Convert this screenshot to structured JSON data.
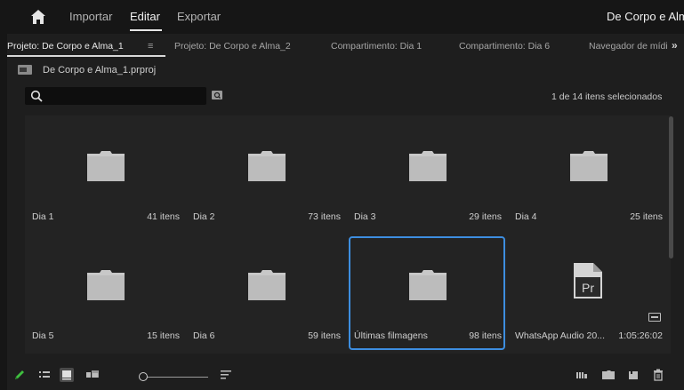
{
  "menu": {
    "items": [
      "Importar",
      "Editar",
      "Exportar"
    ],
    "active": "Editar",
    "document_title": "De Corpo e Alma"
  },
  "tabs": [
    {
      "label": "Projeto: De Corpo e Alma_1"
    },
    {
      "label": "Projeto: De Corpo e Alma_2"
    },
    {
      "label": "Compartimento: Dia 1"
    },
    {
      "label": "Compartimento: Dia 6"
    },
    {
      "label": "Navegador de mídi"
    }
  ],
  "tab_menu_glyph": "≡",
  "tab_more_glyph": "»",
  "project": {
    "filename": "De Corpo e Alma_1.prproj"
  },
  "search": {
    "value": "",
    "placeholder": ""
  },
  "selection_status": "1 de 14 itens selecionados",
  "bins": [
    {
      "name": "Dia 1",
      "count": "41 itens",
      "type": "folder"
    },
    {
      "name": "Dia 2",
      "count": "73 itens",
      "type": "folder"
    },
    {
      "name": "Dia 3",
      "count": "29 itens",
      "type": "folder"
    },
    {
      "name": "Dia 4",
      "count": "25 itens",
      "type": "folder"
    },
    {
      "name": "Dia 5",
      "count": "15 itens",
      "type": "folder"
    },
    {
      "name": "Dia 6",
      "count": "59 itens",
      "type": "folder"
    },
    {
      "name": "Últimas filmagens",
      "count": "98 itens",
      "type": "folder",
      "selected": true
    },
    {
      "name": "WhatsApp Audio 20...",
      "count": "1:05:26:02",
      "type": "premiere-sequence",
      "icon_text": "Pr"
    }
  ],
  "colors": {
    "selection_border": "#3d8ee0",
    "pen_tool_icon": "#3fbf3f",
    "background": "#1e1e1e"
  },
  "toolbar_icons": [
    "pencil-icon",
    "list-view-icon",
    "icon-view-icon",
    "freeform-view-icon",
    "zoom-slider",
    "sort-icon",
    "automate-to-sequence-icon",
    "new-bin-icon",
    "new-item-icon",
    "trash-icon"
  ]
}
